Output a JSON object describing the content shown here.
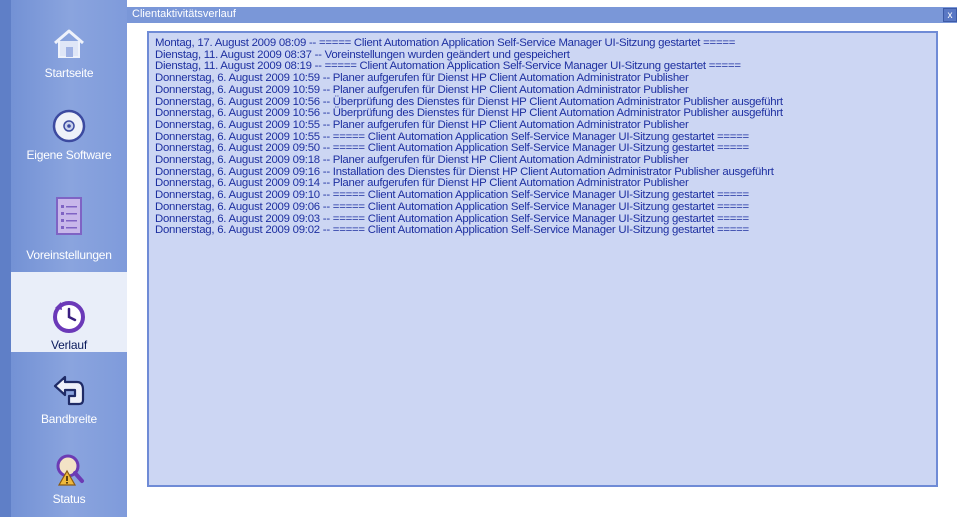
{
  "window": {
    "title": "Clientaktivitätsverlauf",
    "close_label": "x"
  },
  "sidebar": {
    "items": [
      {
        "label": "Startseite",
        "icon": "home-icon",
        "active": false
      },
      {
        "label": "Eigene Software",
        "icon": "disc-icon",
        "active": false
      },
      {
        "label": "Voreinstellungen",
        "icon": "document-icon",
        "active": false
      },
      {
        "label": "Verlauf",
        "icon": "history-clock-icon",
        "active": true
      },
      {
        "label": "Bandbreite",
        "icon": "bandwidth-arrow-icon",
        "active": false
      },
      {
        "label": "Status",
        "icon": "status-magnifier-icon",
        "active": false
      }
    ]
  },
  "log": {
    "lines": [
      "Montag, 17. August 2009 08:09 -- ===== Client Automation Application Self-Service Manager UI-Sitzung gestartet =====",
      "Dienstag, 11. August 2009 08:37 -- Voreinstellungen wurden geändert und gespeichert",
      "Dienstag, 11. August 2009 08:19 -- ===== Client Automation Application Self-Service Manager UI-Sitzung gestartet =====",
      "Donnerstag, 6. August 2009 10:59 -- Planer aufgerufen für Dienst HP Client Automation Administrator Publisher",
      "Donnerstag, 6. August 2009 10:59 -- Planer aufgerufen für Dienst HP Client Automation Administrator Publisher",
      "Donnerstag, 6. August 2009 10:56 -- Überprüfung des Dienstes für Dienst HP Client Automation Administrator Publisher ausgeführt",
      "Donnerstag, 6. August 2009 10:56 -- Überprüfung des Dienstes für Dienst HP Client Automation Administrator Publisher ausgeführt",
      "Donnerstag, 6. August 2009 10:55 -- Planer aufgerufen für Dienst HP Client Automation Administrator Publisher",
      "Donnerstag, 6. August 2009 10:55 -- ===== Client Automation Application Self-Service Manager UI-Sitzung gestartet =====",
      "Donnerstag, 6. August 2009 09:50 -- ===== Client Automation Application Self-Service Manager UI-Sitzung gestartet =====",
      "Donnerstag, 6. August 2009 09:18 -- Planer aufgerufen für Dienst HP Client Automation Administrator Publisher",
      "Donnerstag, 6. August 2009 09:16 -- Installation des Dienstes für Dienst HP Client Automation Administrator Publisher ausgeführt",
      "Donnerstag, 6. August 2009 09:14 -- Planer aufgerufen für Dienst HP Client Automation Administrator Publisher",
      "Donnerstag, 6. August 2009 09:10 -- ===== Client Automation Application Self-Service Manager UI-Sitzung gestartet =====",
      "Donnerstag, 6. August 2009 09:06 -- ===== Client Automation Application Self-Service Manager UI-Sitzung gestartet =====",
      "Donnerstag, 6. August 2009 09:03 -- ===== Client Automation Application Self-Service Manager UI-Sitzung gestartet =====",
      "Donnerstag, 6. August 2009 09:02 -- ===== Client Automation Application Self-Service Manager UI-Sitzung gestartet ====="
    ]
  },
  "colors": {
    "sidebar_bg": "#7f9bdb",
    "active_item_bg": "#e9eef9",
    "log_bg": "#ccd6f3",
    "log_border": "#6f8bd6",
    "log_text": "#1d2fa0"
  }
}
